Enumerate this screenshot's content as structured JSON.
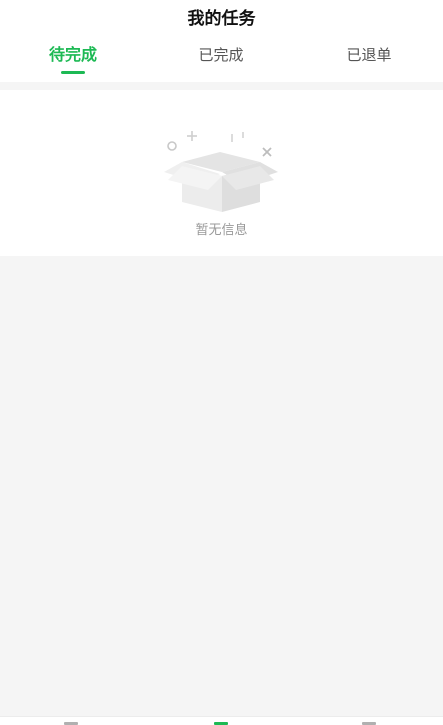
{
  "header": {
    "title": "我的任务"
  },
  "tabs": [
    {
      "label": "待完成",
      "active": true
    },
    {
      "label": "已完成",
      "active": false
    },
    {
      "label": "已退单",
      "active": false
    }
  ],
  "empty_state": {
    "message": "暂无信息",
    "icon": "empty-box-icon"
  },
  "colors": {
    "accent": "#1db954",
    "background": "#f5f5f5",
    "muted_text": "#999999"
  }
}
